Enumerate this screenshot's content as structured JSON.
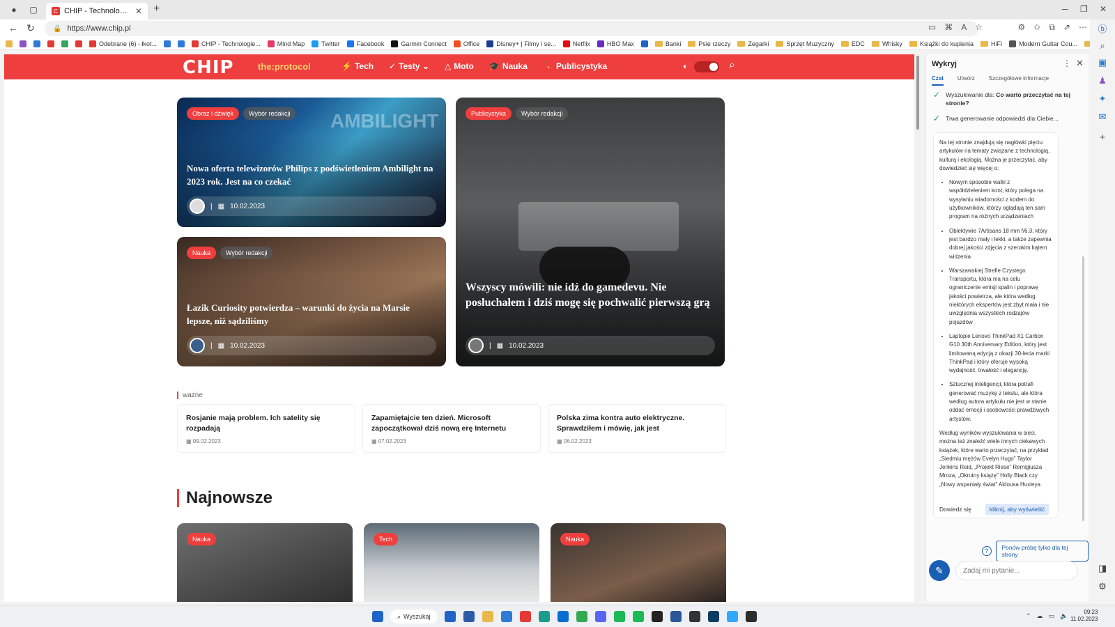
{
  "browser": {
    "tab_title": "CHIP - Technologie mamy we",
    "url": "https://www.chip.pl",
    "favorites": [
      {
        "label": "",
        "color": "#e8b84a"
      },
      {
        "label": "",
        "color": "#8a53c2"
      },
      {
        "label": "",
        "color": "#2e7bd6"
      },
      {
        "label": "",
        "color": "#e53935"
      },
      {
        "label": "",
        "color": "#3aa35b"
      },
      {
        "label": "",
        "color": "#e53935"
      },
      {
        "label": "Odebrane (6) - łkot...",
        "color": "#e53935"
      },
      {
        "label": "",
        "color": "#2e7bd6"
      },
      {
        "label": "",
        "color": "#2e7bd6"
      },
      {
        "label": "CHIP - Technologie...",
        "color": "#e53935"
      },
      {
        "label": "Mind Map",
        "color": "#e23a6a"
      },
      {
        "label": "Twitter",
        "color": "#1d9bf0"
      },
      {
        "label": "Facebook",
        "color": "#1877f2"
      },
      {
        "label": "Garmin Connect",
        "color": "#111111"
      },
      {
        "label": "Office",
        "color": "#f25022"
      },
      {
        "label": "Disney+ | Filmy i se...",
        "color": "#1a3e8c"
      },
      {
        "label": "Netflix",
        "color": "#e50914"
      },
      {
        "label": "HBO Max",
        "color": "#6a2bbf"
      },
      {
        "label": "",
        "color": "#1e63c6"
      },
      {
        "label": "Banki",
        "folder": true
      },
      {
        "label": "Psie rzeczy",
        "folder": true
      },
      {
        "label": "Zegarki",
        "folder": true
      },
      {
        "label": "Sprzęt Muzyczny",
        "folder": true
      },
      {
        "label": "EDC",
        "folder": true
      },
      {
        "label": "Whisky",
        "folder": true
      },
      {
        "label": "Książki do kupienia",
        "folder": true
      },
      {
        "label": "HiFi",
        "folder": true
      },
      {
        "label": "Modern Guitar Cou...",
        "color": "#555555"
      },
      {
        "label": "Anime",
        "folder": true
      },
      {
        "label": "Siłownia",
        "folder": true
      }
    ]
  },
  "site": {
    "logo": "CHIP",
    "protocol": "the:protocol",
    "nav": [
      {
        "icon": "⚡",
        "label": "Tech"
      },
      {
        "icon": "✓",
        "label": "Testy ⌄"
      },
      {
        "icon": "△",
        "label": "Moto"
      },
      {
        "icon": "🎓",
        "label": "Nauka"
      },
      {
        "icon": "🔖",
        "label": "Publicystyka"
      }
    ],
    "featured": [
      {
        "category": "Obraz i dźwięk",
        "tag": "Wybór redakcji",
        "title": "Nowa oferta telewizorów Philips z podświetleniem Ambilight na 2023 rok. Jest na co czekać",
        "date": "10.02.2023",
        "watermark": "AMBILIGHT"
      },
      {
        "category": "Nauka",
        "tag": "Wybór redakcji",
        "title": "Łazik Curiosity potwierdza – warunki do życia na Marsie lepsze, niż sądziliśmy",
        "date": "10.02.2023"
      },
      {
        "category": "Publicystyka",
        "tag": "Wybór redakcji",
        "title": "Wszyscy mówili: nie idź do gamedevu. Nie posłuchałem i dziś mogę się pochwalić pierwszą grą",
        "date": "10.02.2023"
      }
    ],
    "important_label": "ważne",
    "important": [
      {
        "title": "Rosjanie mają problem. Ich satelity się rozpadają",
        "date": "09.02.2023"
      },
      {
        "title": "Zapamiętajcie ten dzień. Microsoft zapoczątkował dziś nową erę Internetu",
        "date": "07.02.2023"
      },
      {
        "title": "Polska zima kontra auto elektryczne. Sprawdziłem i mówię, jak jest",
        "date": "06.02.2023"
      }
    ],
    "latest_heading": "Najnowsze",
    "latest": [
      {
        "category": "Nauka"
      },
      {
        "category": "Tech"
      },
      {
        "category": "Nauka"
      }
    ]
  },
  "sidebar": {
    "title": "Wykryj",
    "tabs": [
      "Czat",
      "Utwórz",
      "Szczegółowe informacje"
    ],
    "status1_prefix": "Wyszukiwanie dla: ",
    "status1_query": "Co warto przeczytać na tej stronie?",
    "status2": "Trwa generowanie odpowiedzi dla Ciebie...",
    "intro": "Na tej stronie znajdują się nagłówki pięciu artykułów na tematy związane z technologią, kulturą i ekologią. Można je przeczytać, aby dowiedzieć się więcej o:",
    "bullets": [
      "Nowym sposobie walki z współdzieleniem kont, który polega na wysyłaniu wiadomości z kodem do użytkowników, którzy oglądają ten sam program na różnych urządzeniach",
      "Obiektywie 7Artisans 18 mm f/6.3, który jest bardzo mały i lekki, a także zapewnia dobrej jakości zdjęcia z szerokim kątem widzenia",
      "Warszawskiej Strefie Czystego Transportu, która ma na celu ograniczenie emisji spalin i poprawę jakości powietrza, ale która według niektórych ekspertów jest zbyt mała i nie uwzględnia wszystkich rodzajów pojazdów",
      "Laptopie Lenovo ThinkPad X1 Carbon G10 30th Anniversary Edition, który jest limitowaną edycją z okazji 30-lecia marki ThinkPad i który oferuje wysoką wydajność, trwałość i elegancję.",
      "Sztucznej inteligencji, która potrafi generować muzykę z tekstu, ale która według autora artykułu nie jest w stanie oddać emocji i osobowości prawdziwych artystów."
    ],
    "outro": "Według wyników wyszukiwania w sieci, można też znaleźć wiele innych ciekawych książek, które warto przeczytać, na przykład „Siedmiu mężów Evelyn Hugo” Taylor Jenkins Reid, „Projekt Riese” Remigiusza Mroza, „Okrutny książę” Holly Black czy „Nowy wspaniały świat” Aldousa Huxleya",
    "learn_more": "Dowiedz się",
    "learn_more_link": "kliknij, aby wyświetlić",
    "retry": "Ponów próbę tylko dla tej strony",
    "ask_placeholder": "Zadaj mi pytanie..."
  },
  "taskbar": {
    "search": "Wyszukaj",
    "time": "09:23",
    "date": "11.02.2023",
    "apps": [
      "#1e63c6",
      "#2f5aa8",
      "#e8b84a",
      "#2e7bd6",
      "#e53935",
      "#1c9c8c",
      "#0a6ed1",
      "#34a853",
      "#5865f2",
      "#1db954",
      "#1db954",
      "#232323",
      "#2b579a",
      "#333333",
      "#0a3d62",
      "#31a8ff",
      "#2d2d2d"
    ]
  }
}
